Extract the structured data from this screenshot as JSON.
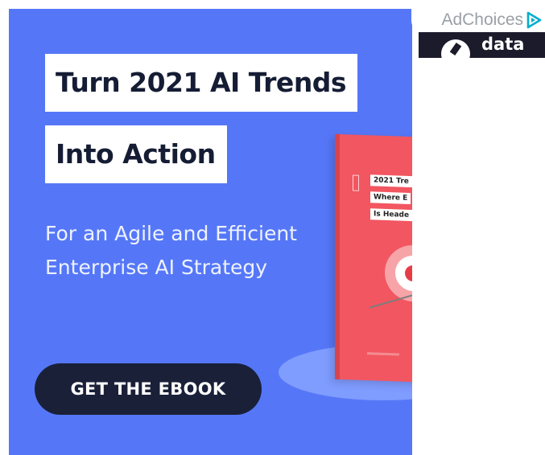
{
  "ad": {
    "headline_line1": "Turn 2021 AI Trends",
    "headline_line2": "Into Action",
    "subheading_line1": "For an Agile and Efficient",
    "subheading_line2": "Enterprise AI Strategy",
    "cta_label": "GET THE EBOOK",
    "book": {
      "cover_line1": "2021 Tre",
      "cover_line2": "Where E",
      "cover_line3": "Is Heade"
    }
  },
  "adchoices": {
    "label": "AdChoices",
    "icon": "adchoices-triangle-icon"
  },
  "sponsor_tile": {
    "text": "data",
    "icon": "brand-logo-icon"
  },
  "colors": {
    "ad_background": "#5577f7",
    "cta_background": "#1a2038",
    "book_cover": "#f25660",
    "adchoices_accent": "#00aecd"
  }
}
